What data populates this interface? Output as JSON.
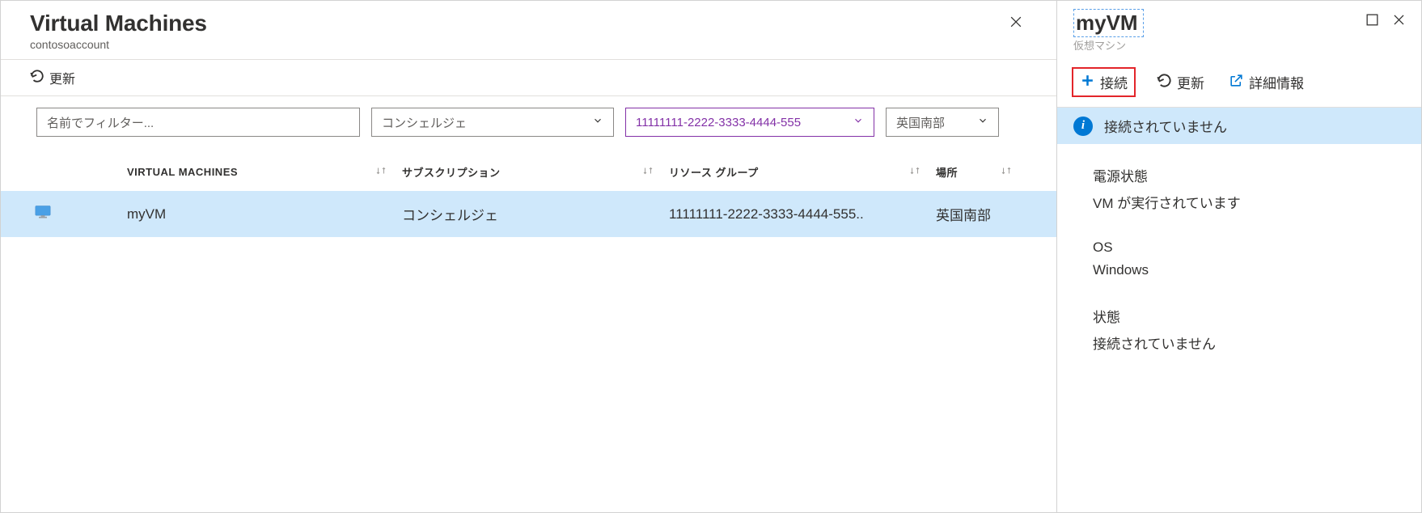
{
  "left": {
    "title": "Virtual Machines",
    "subtitle": "contosoaccount",
    "refresh_label": "更新",
    "filter_placeholder": "名前でフィルター...",
    "subscription_select": "コンシェルジェ",
    "resourcegroup_select": "11111111-2222-3333-4444-555",
    "location_select": "英国南部",
    "columns": {
      "vm": "VIRTUAL MACHINES",
      "subscription": "サブスクリプション",
      "resource_group": "リソース グループ",
      "location": "場所"
    },
    "rows": [
      {
        "name": "myVM",
        "subscription": "コンシェルジェ",
        "resource_group": "11111111-2222-3333-4444-555..",
        "location": "英国南部"
      }
    ]
  },
  "right": {
    "title": "myVM",
    "subtitle": "仮想マシン",
    "connect_label": "接続",
    "refresh_label": "更新",
    "more_label": "詳細情報",
    "info_bar": "接続されていません",
    "details": {
      "power_label": "電源状態",
      "power_value": "VM が実行されています",
      "os_label": "OS",
      "os_value": "Windows",
      "state_label": "状態",
      "state_value": "接続されていません"
    }
  }
}
